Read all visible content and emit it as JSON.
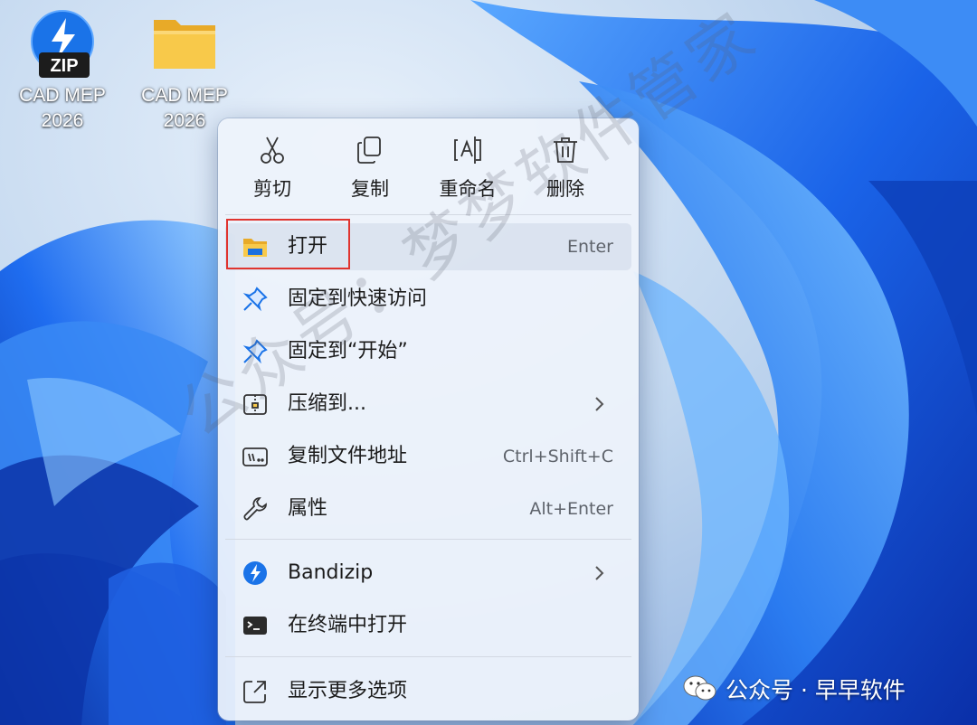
{
  "desktop": {
    "icons": [
      {
        "label": "CAD MEP\n2026",
        "type": "zip-archive",
        "badge": "ZIP"
      },
      {
        "label": "CAD MEP\n2026",
        "type": "folder"
      }
    ]
  },
  "context_menu": {
    "quick_actions": [
      {
        "label": "剪切",
        "icon": "scissors-icon"
      },
      {
        "label": "复制",
        "icon": "copy-icon"
      },
      {
        "label": "重命名",
        "icon": "rename-icon"
      },
      {
        "label": "删除",
        "icon": "trash-icon"
      }
    ],
    "items": [
      {
        "label": "打开",
        "shortcut": "Enter",
        "icon": "folder-open-icon",
        "highlighted": true
      },
      {
        "label": "固定到快速访问",
        "icon": "pin-icon"
      },
      {
        "label": "固定到“开始”",
        "icon": "pin-icon"
      },
      {
        "label": "压缩到...",
        "icon": "zip-archive-icon",
        "submenu": true
      },
      {
        "label": "复制文件地址",
        "shortcut": "Ctrl+Shift+C",
        "icon": "copy-path-icon"
      },
      {
        "label": "属性",
        "shortcut": "Alt+Enter",
        "icon": "wrench-icon"
      },
      {
        "label": "Bandizip",
        "icon": "bandizip-icon",
        "submenu": true
      },
      {
        "label": "在终端中打开",
        "icon": "terminal-icon"
      },
      {
        "label": "显示更多选项",
        "icon": "more-options-icon"
      }
    ]
  },
  "watermarks": {
    "diagonal": "公众号：梦梦软件管家",
    "credit": "公众号 · 早早软件"
  },
  "colors": {
    "accent_blue": "#1a73e8",
    "highlight_red": "#e0342f",
    "folder_yellow": "#f8c94a"
  }
}
